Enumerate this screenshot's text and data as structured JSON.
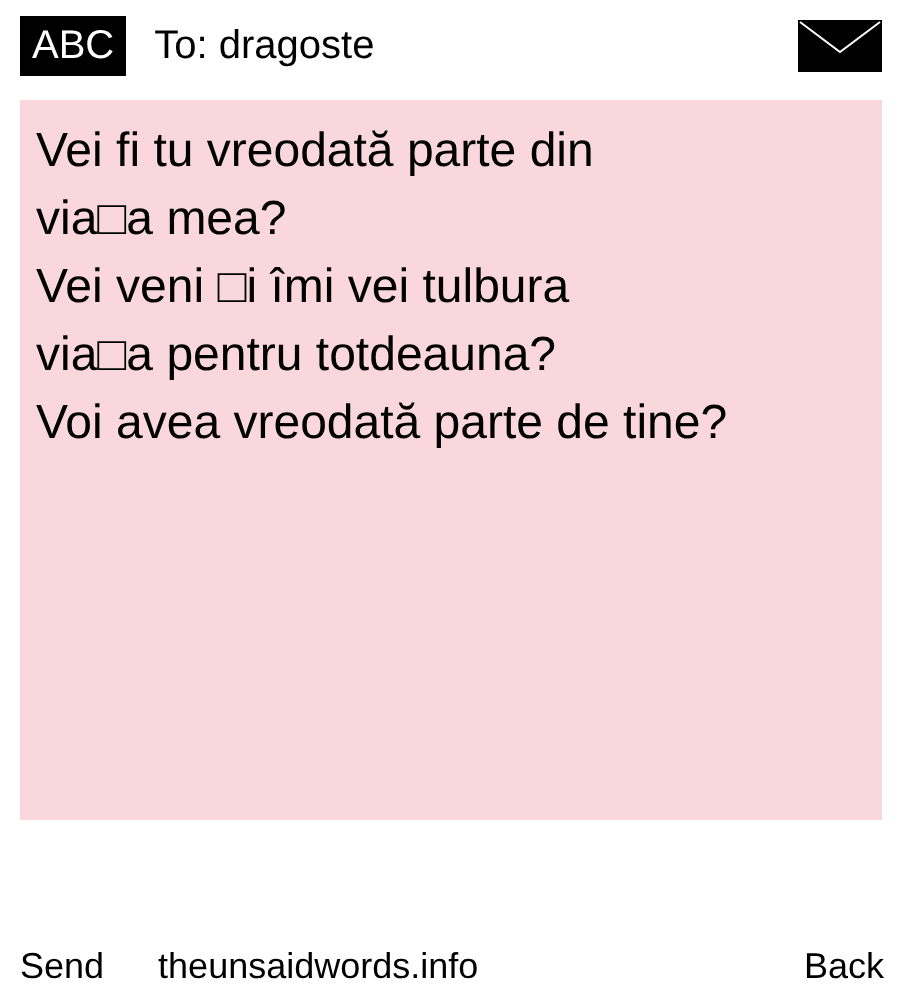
{
  "header": {
    "input_mode": "ABC",
    "recipient": "To: dragoste"
  },
  "message": {
    "text": "Vei fi tu vreodată parte din\nvia□a mea?\nVei veni □i îmi vei tulbura\nvia□a pentru totdeauna?\nVoi avea vreodată parte de tine?"
  },
  "softkeys": {
    "left": "Send",
    "middle": "theunsaidwords.info",
    "right": "Back"
  }
}
